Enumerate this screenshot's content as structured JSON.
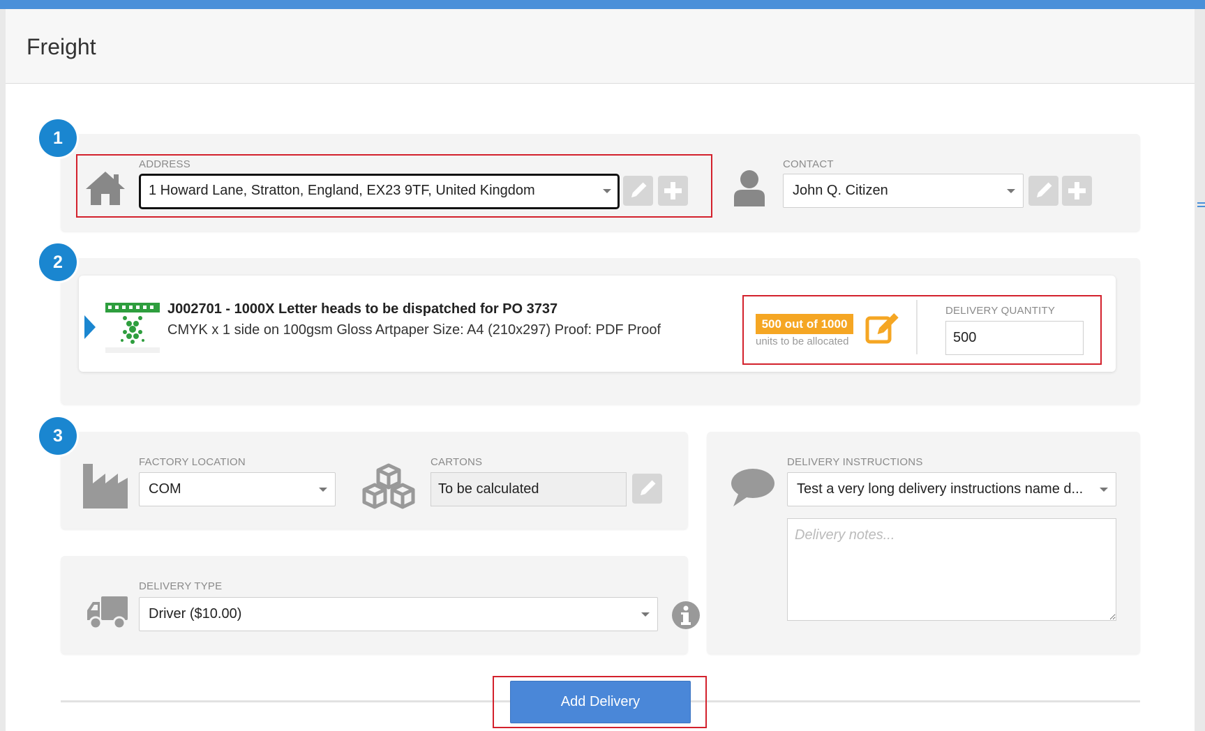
{
  "modal": {
    "title": "Freight"
  },
  "steps": [
    "1",
    "2",
    "3"
  ],
  "address": {
    "label": "ADDRESS",
    "value": "1 Howard Lane, Stratton, England, EX23 9TF, United Kingdom",
    "icon": "house-icon"
  },
  "contact": {
    "label": "CONTACT",
    "value": "John Q. Citizen",
    "icon": "person-icon"
  },
  "job": {
    "title": "J002701 - 1000X Letter heads to be dispatched for PO 3737",
    "description": "CMYK x 1 side on 100gsm Gloss Artpaper Size: A4 (210x297) Proof: PDF Proof",
    "allocation_badge": "500 out of 1000",
    "allocation_note": "units to be allocated",
    "delivery_quantity_label": "DELIVERY QUANTITY",
    "delivery_quantity": "500"
  },
  "factory": {
    "label": "FACTORY LOCATION",
    "value": "COM",
    "icon": "factory-icon"
  },
  "cartons": {
    "label": "CARTONS",
    "value": "To be calculated",
    "icon": "boxes-icon"
  },
  "delivery_instructions": {
    "label": "DELIVERY INSTRUCTIONS",
    "value": "Test a very long delivery instructions name d...",
    "notes_placeholder": "Delivery notes...",
    "icon": "speech-bubble-icon"
  },
  "delivery_type": {
    "label": "DELIVERY TYPE",
    "value": "Driver ($10.00)",
    "icon": "truck-icon"
  },
  "actions": {
    "add_delivery": "Add Delivery"
  },
  "colors": {
    "accent": "#1a86d0",
    "button": "#4a87d8",
    "highlight": "#d3212c",
    "badge": "#f5a623"
  }
}
